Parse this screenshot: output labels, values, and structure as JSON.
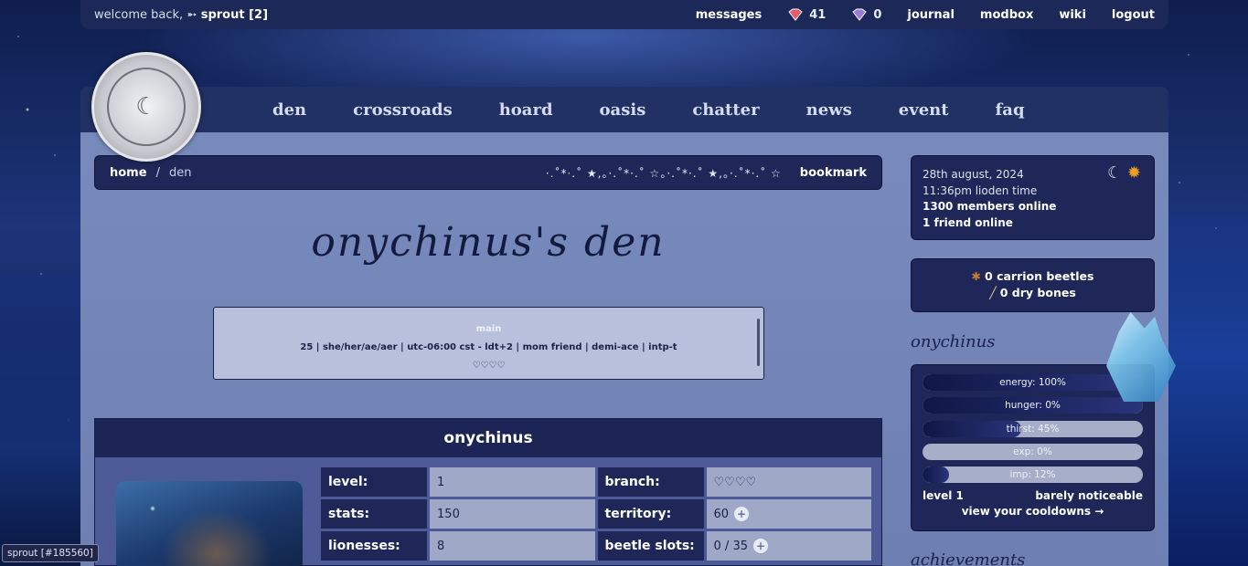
{
  "topbar": {
    "welcome_prefix": "welcome back,",
    "welcome_user": "➵ sprout [2]",
    "messages": "messages",
    "gem_red_count": "41",
    "gem_purple_count": "0",
    "journal": "journal",
    "modbox": "modbox",
    "wiki": "wiki",
    "logout": "logout"
  },
  "nav": [
    "den",
    "crossroads",
    "hoard",
    "oasis",
    "chatter",
    "news",
    "event",
    "faq"
  ],
  "breadcrumb": {
    "home": "home",
    "separator": "/",
    "current": "den",
    "decoration": "·.˚*·.˚ ★,。·.˚*·.˚ ☆。·.˚*·.˚ ★,。·.˚*·.˚ ☆",
    "bookmark": "bookmark"
  },
  "den_title": "onychinus's den",
  "bio": {
    "heading": "main",
    "line": "25 | she/her/ae/aer | utc-06:00 cst - ldt+2 | mom friend | demi-ace | intp-t",
    "hearts": "♡♡♡♡"
  },
  "lion": {
    "name": "onychinus",
    "stats": [
      {
        "k1": "level:",
        "v1": "1",
        "p1": false,
        "k2": "branch:",
        "v2": "♡♡♡♡",
        "p2": false
      },
      {
        "k1": "stats:",
        "v1": "150",
        "p1": false,
        "k2": "territory:",
        "v2": "60",
        "p2": true
      },
      {
        "k1": "lionesses:",
        "v1": "8",
        "p1": false,
        "k2": "beetle slots:",
        "v2": "0 / 35",
        "p2": true
      }
    ]
  },
  "time": {
    "date": "28th august, 2024",
    "time": "11:36pm lioden time",
    "members": "1300 members online",
    "friends": "1 friend online"
  },
  "resources": {
    "beetles": "0 carrion beetles",
    "bones": "0 dry bones"
  },
  "sidebar_name": "onychinus",
  "status_bars": [
    {
      "label": "energy: 100%",
      "value": 100
    },
    {
      "label": "hunger: 0%",
      "value": 100
    },
    {
      "label": "thirst: 45%",
      "value": 45
    },
    {
      "label": "exp: 0%",
      "value": 0
    },
    {
      "label": "imp: 12%",
      "value": 12
    }
  ],
  "level_text": "level 1",
  "level_desc": "barely noticeable",
  "cooldowns": "view your cooldowns →",
  "achievements_title": "achievements",
  "user_tag": "sprout [#185560]",
  "icons": {
    "moon": "moon-icon",
    "sun": "sun-icon",
    "beetle": "beetle-icon",
    "bone": "bone-icon"
  }
}
